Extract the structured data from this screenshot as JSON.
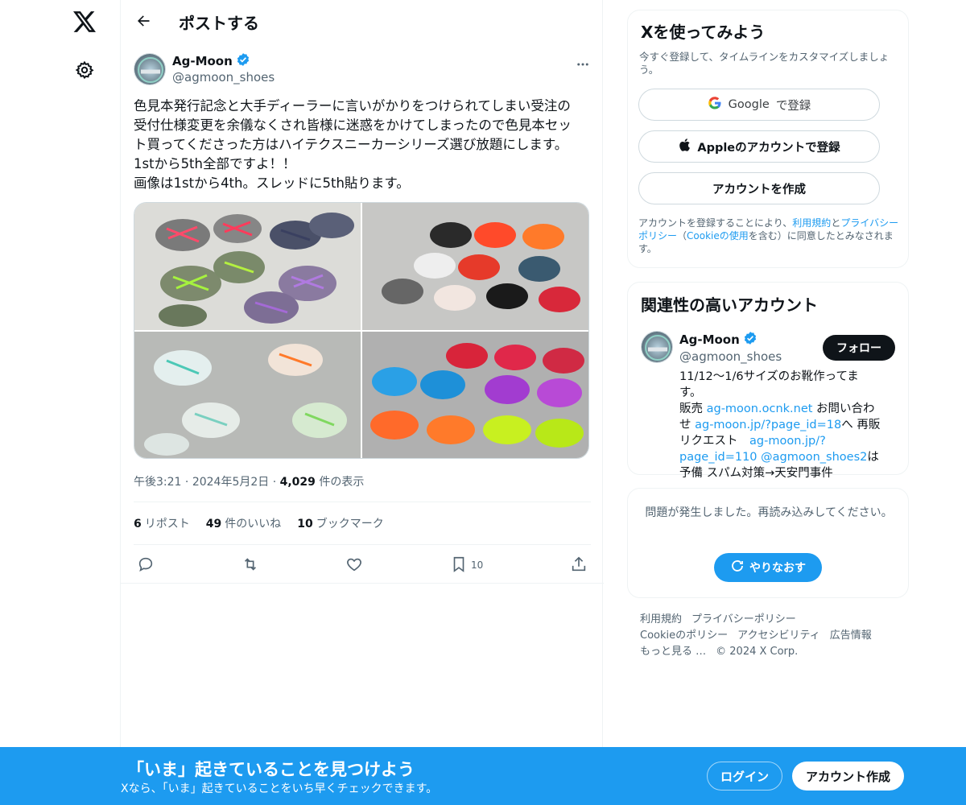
{
  "header": {
    "title": "ポストする",
    "back_icon": "back-arrow-icon"
  },
  "post": {
    "author_name": "Ag-Moon",
    "author_handle": "@agmoon_shoes",
    "avatar_text": "Ag-Moon",
    "text": "色見本発行記念と大手ディーラーに言いがかりをつけられてしまい受注の\n受付仕様変更を余儀なくされ皆様に迷惑をかけてしまったので色見本セッ\nト買ってくださった方はハイテクスニーカーシリーズ選び放題にします。\n1stから5th全部ですよ！！\n画像は1stから4th。スレッドに5th貼ります。",
    "time": "午後3:21",
    "date": "2024年5月2日",
    "views_count": "4,029",
    "views_label": "件の表示",
    "separator": "·",
    "reposts_count": "6",
    "reposts_label": "リポスト",
    "likes_count": "49",
    "likes_label": "件のいいね",
    "bookmarks_count": "10",
    "bookmarks_label": "ブックマーク",
    "bookmark_action_count": "10"
  },
  "signup_card": {
    "title": "Xを使ってみよう",
    "subtitle": "今すぐ登録して、タイムラインをカスタマイズしましょう。",
    "google_button_word": "Google",
    "google_button_suffix": "で登録",
    "apple_button": "Appleのアカウントで登録",
    "create_button": "アカウントを作成",
    "legal_1": "アカウントを登録することにより、",
    "legal_terms": "利用規約",
    "legal_2": "と",
    "legal_privacy": "プライバシーポリシー",
    "legal_3": "（",
    "legal_cookie": "Cookieの使用",
    "legal_4": "を含む）に同意したとみなされます。"
  },
  "relevant": {
    "title": "関連性の高いアカウント",
    "name": "Ag-Moon",
    "handle": "@agmoon_shoes",
    "follow_label": "フォロー",
    "bio_1": "11/12〜1/6サイズのお靴作ってます。",
    "bio_2": "販売 ",
    "bio_link1": "ag-moon.ocnk.net",
    "bio_3": " お問い合わせ ",
    "bio_link2": "ag-moon.jp/?page_id=18",
    "bio_4": "へ 再販リクエスト　",
    "bio_link3": "ag-moon.jp/?page_id=110",
    "bio_link4": "@agmoon_shoes2",
    "bio_5": "は予備 スパム対策→天安門事件"
  },
  "error_card": {
    "message": "問題が発生しました。再読み込みしてください。",
    "retry_label": "やりなおす"
  },
  "footer": {
    "links": [
      "利用規約",
      "プライバシーポリシー",
      "Cookieのポリシー",
      "アクセシビリティ",
      "広告情報",
      "もっと見る …",
      "© 2024 X Corp."
    ]
  },
  "bottom_bar": {
    "title": "「いま」起きていることを見つけよう",
    "subtitle": "Xなら、「いま」起きていることをいち早くチェックできます。",
    "login_label": "ログイン",
    "signup_label": "アカウント作成"
  },
  "colors": {
    "accent": "#1d9bf0",
    "text": "#0f1419",
    "muted": "#536471",
    "verified": "#1d9bf0"
  }
}
